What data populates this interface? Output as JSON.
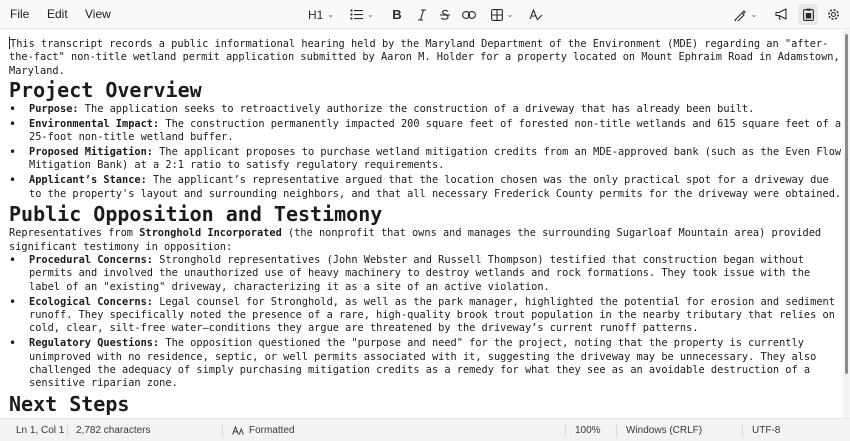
{
  "menu": {
    "file": "File",
    "edit": "Edit",
    "view": "View"
  },
  "toolbar": {
    "heading_level": "H1"
  },
  "document": {
    "intro": "This transcript records a public informational hearing held by the Maryland Department of the Environment (MDE) regarding an \"after-the-fact\" non-title wetland permit application submitted by Aaron M. Holder for a property located on Mount Ephraim Road in Adamstown, Maryland.",
    "sections": [
      {
        "heading": "Project Overview",
        "items": [
          {
            "term": "Purpose:",
            "text": " The application seeks to retroactively authorize the construction of a driveway that has already been built."
          },
          {
            "term": "Environmental Impact:",
            "text": " The construction permanently impacted 200 square feet of forested non-title wetlands and 615 square feet of a 25-foot non-title wetland buffer."
          },
          {
            "term": "Proposed Mitigation:",
            "text": " The applicant proposes to purchase wetland mitigation credits from an MDE-approved bank (such as the Even Flow Mitigation Bank) at a 2:1 ratio to satisfy regulatory requirements."
          },
          {
            "term": "Applicant’s Stance:",
            "text": " The applicant’s representative argued that the location chosen was the only practical spot for a driveway due to the property's layout and surrounding neighbors, and that all necessary Frederick County permits for the driveway were obtained."
          }
        ]
      },
      {
        "heading": "Public Opposition and Testimony",
        "para_pre": "Representatives from ",
        "para_strong": "Stronghold Incorporated",
        "para_post": " (the nonprofit that owns and manages the surrounding Sugarloaf Mountain area) provided significant testimony in opposition:",
        "items": [
          {
            "term": "Procedural Concerns:",
            "text": " Stronghold representatives (John Webster and Russell Thompson) testified that construction began without permits and involved the unauthorized use of heavy machinery to destroy wetlands and rock formations. They took issue with the label of an \"existing\" driveway, characterizing it as a site of an active violation."
          },
          {
            "term": "Ecological Concerns:",
            "text": " Legal counsel for Stronghold, as well as the park manager, highlighted the potential for erosion and sediment runoff. They specifically noted the presence of a rare, high-quality brook trout population in the nearby tributary that relies on cold, clear, silt-free water—conditions they argue are threatened by the driveway’s current runoff patterns."
          },
          {
            "term": "Regulatory Questions:",
            "text": " The opposition questioned the \"purpose and need\" for the project, noting that the property is currently unimproved with no residence, septic, or well permits associated with it, suggesting the driveway may be unnecessary. They also challenged the adequacy of simply purchasing mitigation credits as a remedy for what they see as an avoidable destruction of a sensitive riparian zone."
          }
        ]
      },
      {
        "heading": "Next Steps"
      }
    ]
  },
  "status": {
    "position": "Ln 1, Col 1",
    "characters": "2,782 characters",
    "format": "Formatted",
    "zoom": "100%",
    "line_ending": "Windows (CRLF)",
    "encoding": "UTF-8"
  }
}
